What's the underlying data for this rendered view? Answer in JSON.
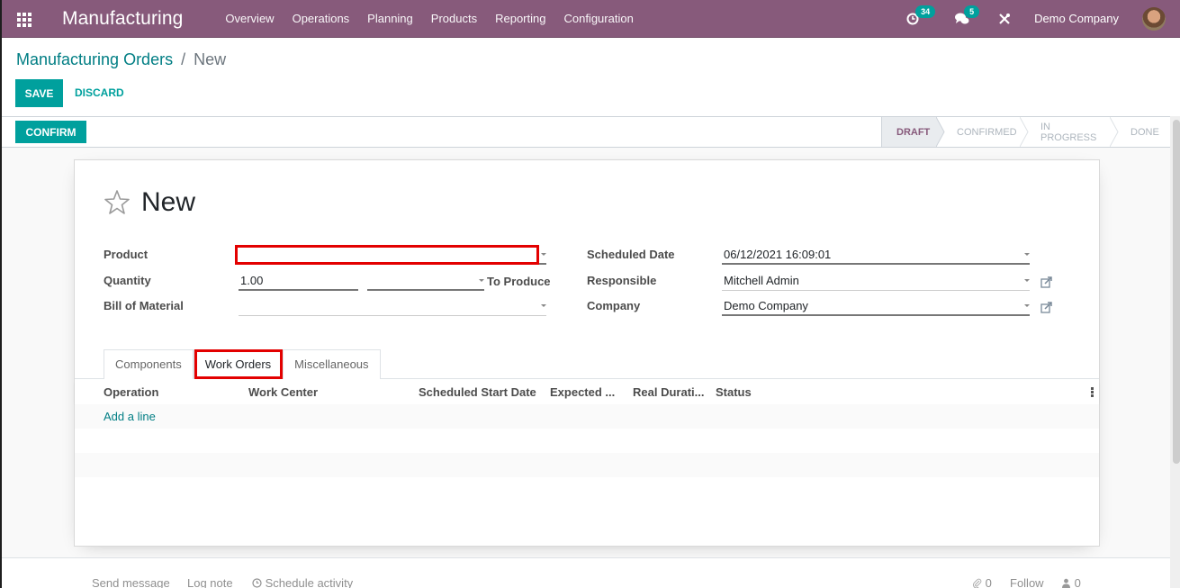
{
  "navbar": {
    "app_name": "Manufacturing",
    "menu": [
      "Overview",
      "Operations",
      "Planning",
      "Products",
      "Reporting",
      "Configuration"
    ],
    "activity_count": "34",
    "message_count": "5",
    "company": "Demo Company",
    "brand_color": "#875a7b"
  },
  "breadcrumb": {
    "parent": "Manufacturing Orders",
    "separator": "/",
    "current": "New"
  },
  "actions": {
    "save": "SAVE",
    "discard": "DISCARD",
    "confirm": "CONFIRM"
  },
  "statusbar": {
    "stages": [
      "DRAFT",
      "CONFIRMED",
      "IN PROGRESS",
      "DONE"
    ],
    "active_stage": "DRAFT"
  },
  "form": {
    "title": "New",
    "left": {
      "product_label": "Product",
      "product_value": "",
      "quantity_label": "Quantity",
      "quantity_value": "1.00",
      "uom_value": "",
      "to_produce_label": "To Produce",
      "bom_label": "Bill of Material",
      "bom_value": ""
    },
    "right": {
      "scheduled_date_label": "Scheduled Date",
      "scheduled_date_value": "06/12/2021 16:09:01",
      "responsible_label": "Responsible",
      "responsible_value": "Mitchell Admin",
      "company_label": "Company",
      "company_value": "Demo Company"
    }
  },
  "tabs": [
    {
      "label": "Components",
      "active": false
    },
    {
      "label": "Work Orders",
      "active": true
    },
    {
      "label": "Miscellaneous",
      "active": false
    }
  ],
  "table": {
    "columns": [
      "Operation",
      "Work Center",
      "Scheduled Start Date",
      "Expected ...",
      "Real Durati...",
      "Status"
    ],
    "add_line": "Add a line"
  },
  "chatter": {
    "send_message": "Send message",
    "log_note": "Log note",
    "schedule_activity": "Schedule activity",
    "attachments": "0",
    "follow": "Follow",
    "followers": "0"
  },
  "accent_color": "#00a09d"
}
